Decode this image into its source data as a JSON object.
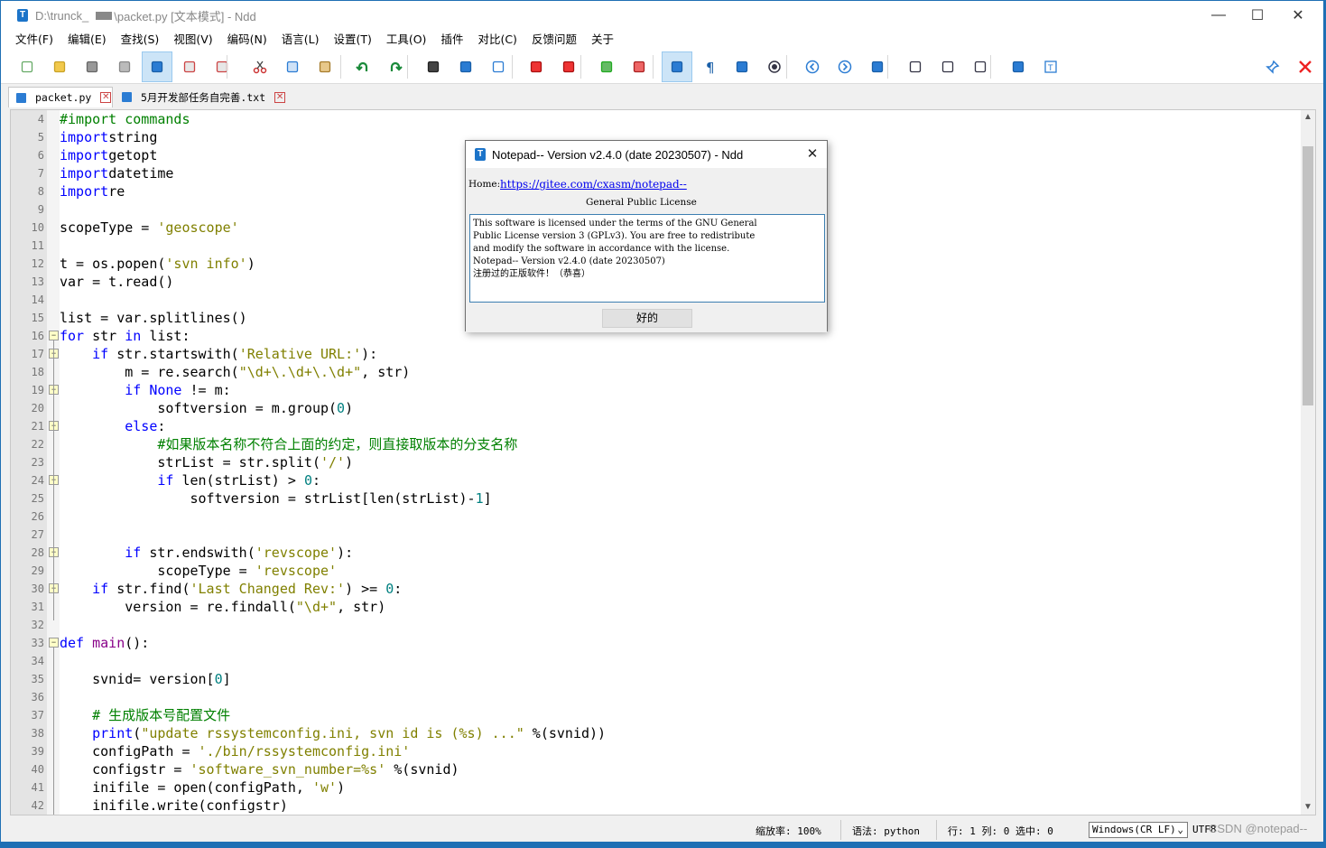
{
  "window": {
    "title_path": "D:\\trunck_",
    "title_rest": "\\packet.py [文本模式] - Ndd",
    "app_icon": "T",
    "min": "—",
    "max": "☐",
    "close": "✕"
  },
  "menu": [
    "文件(F)",
    "编辑(E)",
    "查找(S)",
    "视图(V)",
    "编码(N)",
    "语言(L)",
    "设置(T)",
    "工具(O)",
    "插件",
    "对比(C)",
    "反馈问题",
    "关于"
  ],
  "tabs": [
    {
      "label": "packet.py",
      "active": true
    },
    {
      "label": "5月开发部任务自完善.txt",
      "active": false
    }
  ],
  "code": [
    {
      "n": "4",
      "t": [
        [
          "c",
          "#import commands"
        ]
      ]
    },
    {
      "n": "5",
      "t": [
        [
          "k",
          "import"
        ],
        [
          "",
          "string"
        ]
      ]
    },
    {
      "n": "6",
      "t": [
        [
          "k",
          "import"
        ],
        [
          "",
          "getopt"
        ]
      ]
    },
    {
      "n": "7",
      "t": [
        [
          "k",
          "import"
        ],
        [
          "",
          "datetime"
        ]
      ]
    },
    {
      "n": "8",
      "t": [
        [
          "k",
          "import"
        ],
        [
          "",
          "re"
        ]
      ]
    },
    {
      "n": "9",
      "t": []
    },
    {
      "n": "10",
      "t": [
        [
          "",
          "scopeType = "
        ],
        [
          "s",
          "'geoscope'"
        ]
      ]
    },
    {
      "n": "11",
      "t": []
    },
    {
      "n": "12",
      "t": [
        [
          "",
          "t = os.popen("
        ],
        [
          "s",
          "'svn info'"
        ],
        [
          "",
          ")"
        ]
      ]
    },
    {
      "n": "13",
      "t": [
        [
          "",
          "var = t.read()"
        ]
      ]
    },
    {
      "n": "14",
      "t": []
    },
    {
      "n": "15",
      "t": [
        [
          "",
          "list = var.splitlines()"
        ]
      ]
    },
    {
      "n": "16",
      "t": [
        [
          "k",
          "for"
        ],
        [
          "",
          " str "
        ],
        [
          "k",
          "in"
        ],
        [
          "",
          " list:"
        ]
      ]
    },
    {
      "n": "17",
      "t": [
        [
          "",
          "    "
        ],
        [
          "k",
          "if"
        ],
        [
          "",
          " str.startswith("
        ],
        [
          "s",
          "'Relative URL:'"
        ],
        [
          "",
          "):"
        ]
      ]
    },
    {
      "n": "18",
      "t": [
        [
          "",
          "        m = re.search("
        ],
        [
          "s",
          "\"\\d+\\.\\d+\\.\\d+\""
        ],
        [
          "",
          ", str)"
        ]
      ]
    },
    {
      "n": "19",
      "t": [
        [
          "",
          "        "
        ],
        [
          "k",
          "if"
        ],
        [
          "",
          ""
        ],
        [
          "k",
          " None"
        ],
        [
          "",
          " != m:"
        ]
      ]
    },
    {
      "n": "20",
      "t": [
        [
          "",
          "            softversion = m.group("
        ],
        [
          "n",
          "0"
        ],
        [
          "",
          ")"
        ]
      ]
    },
    {
      "n": "21",
      "t": [
        [
          "",
          "        "
        ],
        [
          "k",
          "else"
        ],
        [
          "",
          ":"
        ]
      ]
    },
    {
      "n": "22",
      "t": [
        [
          "",
          "            "
        ],
        [
          "c",
          "#如果版本名称不符合上面的约定，则直接取版本的分支名称"
        ]
      ]
    },
    {
      "n": "23",
      "t": [
        [
          "",
          "            strList = str.split("
        ],
        [
          "s",
          "'/'"
        ],
        [
          "",
          ")"
        ]
      ]
    },
    {
      "n": "24",
      "t": [
        [
          "",
          "            "
        ],
        [
          "k",
          "if"
        ],
        [
          "",
          " len(strList) > "
        ],
        [
          "n",
          "0"
        ],
        [
          "",
          ":"
        ]
      ]
    },
    {
      "n": "25",
      "t": [
        [
          "",
          "                softversion = strList[len(strList)-"
        ],
        [
          "n",
          "1"
        ],
        [
          "",
          "]"
        ]
      ]
    },
    {
      "n": "26",
      "t": []
    },
    {
      "n": "27",
      "t": []
    },
    {
      "n": "28",
      "t": [
        [
          "",
          "        "
        ],
        [
          "k",
          "if"
        ],
        [
          "",
          " str.endswith("
        ],
        [
          "s",
          "'revscope'"
        ],
        [
          "",
          "):"
        ]
      ]
    },
    {
      "n": "29",
      "t": [
        [
          "",
          "            scopeType = "
        ],
        [
          "s",
          "'revscope'"
        ]
      ]
    },
    {
      "n": "30",
      "t": [
        [
          "",
          "    "
        ],
        [
          "k",
          "if"
        ],
        [
          "",
          " str.find("
        ],
        [
          "s",
          "'Last Changed Rev:'"
        ],
        [
          "",
          ") >= "
        ],
        [
          "n",
          "0"
        ],
        [
          "",
          ":"
        ]
      ]
    },
    {
      "n": "31",
      "t": [
        [
          "",
          "        version = re.findall("
        ],
        [
          "s",
          "\"\\d+\""
        ],
        [
          "",
          ", str)"
        ]
      ]
    },
    {
      "n": "32",
      "t": []
    },
    {
      "n": "33",
      "t": [
        [
          "k",
          "def"
        ],
        [
          "",
          ""
        ],
        [
          "fn",
          " main"
        ],
        [
          "",
          "():"
        ]
      ]
    },
    {
      "n": "34",
      "t": []
    },
    {
      "n": "35",
      "t": [
        [
          "",
          "    svnid= version["
        ],
        [
          "n",
          "0"
        ],
        [
          "",
          "]"
        ]
      ]
    },
    {
      "n": "36",
      "t": []
    },
    {
      "n": "37",
      "t": [
        [
          "",
          "    "
        ],
        [
          "c",
          "# 生成版本号配置文件"
        ]
      ]
    },
    {
      "n": "38",
      "t": [
        [
          "",
          "    "
        ],
        [
          "k",
          "print"
        ],
        [
          "",
          "("
        ],
        [
          "s",
          "\"update rssystemconfig.ini, svn id is (%s) ...\""
        ],
        [
          "",
          " %(svnid))"
        ]
      ]
    },
    {
      "n": "39",
      "t": [
        [
          "",
          "    configPath = "
        ],
        [
          "s",
          "'./bin/rssystemconfig.ini'"
        ]
      ]
    },
    {
      "n": "40",
      "t": [
        [
          "",
          "    configstr = "
        ],
        [
          "s",
          "'software_svn_number=%s'"
        ],
        [
          "",
          " %(svnid)"
        ]
      ]
    },
    {
      "n": "41",
      "t": [
        [
          "",
          "    inifile = open(configPath, "
        ],
        [
          "s",
          "'w'"
        ],
        [
          "",
          ")"
        ]
      ]
    },
    {
      "n": "42",
      "t": [
        [
          "",
          "    inifile.write(configstr)"
        ]
      ]
    }
  ],
  "status": {
    "zoom": "缩放率: 100%",
    "lang": "语法: python",
    "pos": "行: 1 列: 0 选中: 0",
    "eol": "Windows(CR LF)",
    "enc": "UTF8",
    "watermark": "CSDN @notepad--"
  },
  "dialog": {
    "title": "Notepad-- Version v2.4.0 (date 20230507) - Ndd",
    "home_label": "Home: ",
    "home_url": "https://gitee.com/cxasm/notepad--",
    "license_title": "General Public License",
    "license_text": "This software is licensed under the terms of the GNU General\nPublic License version 3 (GPLv3). You are free to redistribute\nand modify the software in accordance with the license.\nNotepad-- Version v2.4.0 (date 20230507)\n注册过的正版软件！（恭喜）",
    "ok": "好的"
  }
}
